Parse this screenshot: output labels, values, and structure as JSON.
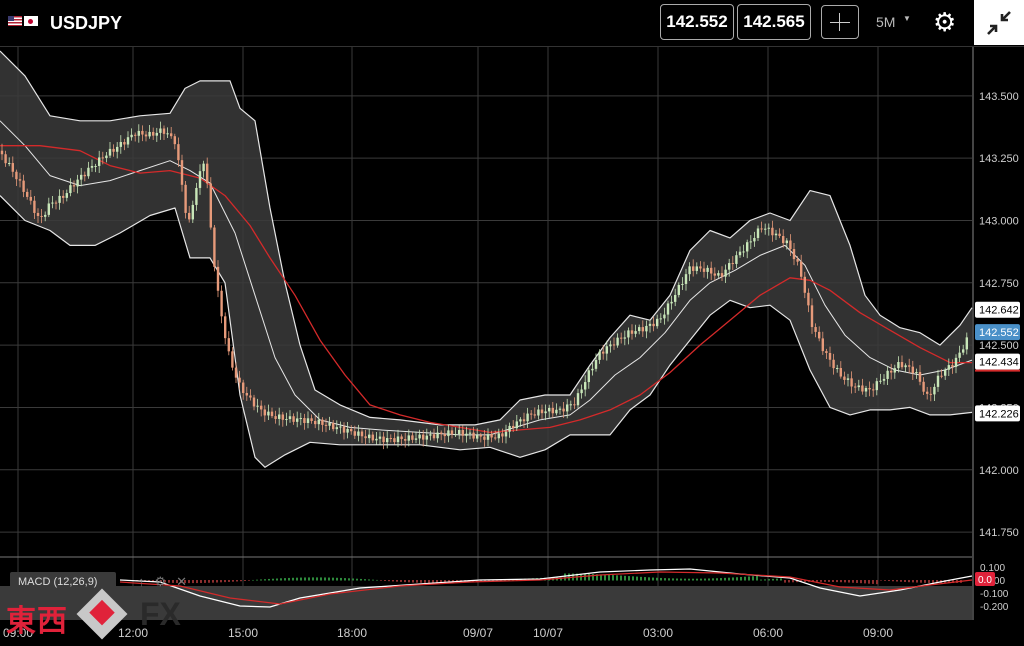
{
  "header": {
    "symbol": "USDJPY",
    "bid": "142.552",
    "ask": "142.565",
    "timeframe": "5M"
  },
  "macd": {
    "label": "MACD (12,26,9)",
    "y_ticks": [
      "0.100",
      "0.000",
      "-0.100",
      "-0.200"
    ],
    "current_value": "0.0"
  },
  "watermark": {
    "kanji": "東西",
    "fx": "FX"
  },
  "chart_data": {
    "type": "candlestick",
    "instrument": "USDJPY",
    "timeframe": "5M",
    "indicators": [
      "Bollinger Bands",
      "Moving Average",
      "MACD (12,26,9)"
    ],
    "x_tick_labels": [
      "09:00",
      "12:00",
      "15:00",
      "18:00",
      "09/07",
      "10/07",
      "03:00",
      "06:00",
      "09:00"
    ],
    "y_tick_labels": [
      "143.500",
      "143.250",
      "143.000",
      "142.750",
      "142.500",
      "142.250",
      "142.000",
      "141.750"
    ],
    "ylim": [
      141.65,
      143.7
    ],
    "price_markers": [
      {
        "value": "142.642",
        "color": "#ffffff"
      },
      {
        "value": "142.552",
        "color": "#4a90c8"
      },
      {
        "value": "142.434",
        "color": "#ffffff"
      },
      {
        "value": "142.226",
        "color": "#ffffff"
      }
    ],
    "close_path": [
      [
        0,
        143.28
      ],
      [
        12,
        143.2
      ],
      [
        25,
        143.1
      ],
      [
        40,
        142.98
      ],
      [
        50,
        143.05
      ],
      [
        62,
        143.08
      ],
      [
        75,
        143.15
      ],
      [
        90,
        143.22
      ],
      [
        105,
        143.28
      ],
      [
        120,
        143.32
      ],
      [
        135,
        143.36
      ],
      [
        150,
        143.34
      ],
      [
        163,
        143.35
      ],
      [
        175,
        143.3
      ],
      [
        183,
        143.1
      ],
      [
        188,
        142.95
      ],
      [
        195,
        143.1
      ],
      [
        205,
        143.25
      ],
      [
        212,
        142.9
      ],
      [
        220,
        142.65
      ],
      [
        230,
        142.45
      ],
      [
        240,
        142.35
      ],
      [
        250,
        142.3
      ],
      [
        262,
        142.25
      ],
      [
        275,
        142.22
      ],
      [
        290,
        142.2
      ],
      [
        310,
        142.18
      ],
      [
        330,
        142.16
      ],
      [
        350,
        142.15
      ],
      [
        370,
        142.14
      ],
      [
        400,
        142.14
      ],
      [
        430,
        142.13
      ],
      [
        460,
        142.13
      ],
      [
        480,
        142.12
      ],
      [
        500,
        142.14
      ],
      [
        515,
        142.2
      ],
      [
        530,
        142.24
      ],
      [
        545,
        142.25
      ],
      [
        560,
        142.24
      ],
      [
        575,
        142.26
      ],
      [
        590,
        142.38
      ],
      [
        600,
        142.45
      ],
      [
        615,
        142.5
      ],
      [
        630,
        142.55
      ],
      [
        645,
        142.58
      ],
      [
        660,
        142.62
      ],
      [
        675,
        142.72
      ],
      [
        690,
        142.82
      ],
      [
        705,
        142.8
      ],
      [
        720,
        142.76
      ],
      [
        735,
        142.83
      ],
      [
        750,
        142.9
      ],
      [
        762,
        142.97
      ],
      [
        775,
        142.95
      ],
      [
        788,
        142.92
      ],
      [
        800,
        142.82
      ],
      [
        812,
        142.6
      ],
      [
        825,
        142.48
      ],
      [
        840,
        142.38
      ],
      [
        855,
        142.32
      ],
      [
        870,
        142.3
      ],
      [
        885,
        142.36
      ],
      [
        900,
        142.42
      ],
      [
        915,
        142.4
      ],
      [
        928,
        142.3
      ],
      [
        940,
        142.4
      ],
      [
        955,
        142.45
      ],
      [
        970,
        142.55
      ]
    ],
    "bb_upper": [
      [
        0,
        143.68
      ],
      [
        25,
        143.58
      ],
      [
        50,
        143.42
      ],
      [
        80,
        143.4
      ],
      [
        110,
        143.4
      ],
      [
        140,
        143.42
      ],
      [
        170,
        143.43
      ],
      [
        185,
        143.53
      ],
      [
        200,
        143.56
      ],
      [
        230,
        143.56
      ],
      [
        240,
        143.45
      ],
      [
        255,
        143.4
      ],
      [
        270,
        143.05
      ],
      [
        285,
        142.75
      ],
      [
        300,
        142.5
      ],
      [
        315,
        142.32
      ],
      [
        340,
        142.26
      ],
      [
        370,
        142.21
      ],
      [
        400,
        142.2
      ],
      [
        440,
        142.18
      ],
      [
        475,
        142.18
      ],
      [
        500,
        142.2
      ],
      [
        520,
        142.28
      ],
      [
        545,
        142.3
      ],
      [
        570,
        142.3
      ],
      [
        590,
        142.42
      ],
      [
        610,
        142.53
      ],
      [
        630,
        142.62
      ],
      [
        650,
        142.6
      ],
      [
        670,
        142.7
      ],
      [
        690,
        142.88
      ],
      [
        710,
        142.96
      ],
      [
        730,
        142.93
      ],
      [
        750,
        143.0
      ],
      [
        770,
        143.03
      ],
      [
        790,
        143.0
      ],
      [
        810,
        143.12
      ],
      [
        830,
        143.1
      ],
      [
        850,
        142.9
      ],
      [
        865,
        142.7
      ],
      [
        880,
        142.62
      ],
      [
        900,
        142.57
      ],
      [
        920,
        142.55
      ],
      [
        940,
        142.5
      ],
      [
        960,
        142.58
      ],
      [
        972,
        142.65
      ]
    ],
    "bb_lower": [
      [
        0,
        143.1
      ],
      [
        25,
        143.0
      ],
      [
        50,
        142.96
      ],
      [
        70,
        142.9
      ],
      [
        95,
        142.9
      ],
      [
        120,
        142.95
      ],
      [
        150,
        143.02
      ],
      [
        175,
        143.05
      ],
      [
        190,
        142.85
      ],
      [
        210,
        142.85
      ],
      [
        225,
        142.75
      ],
      [
        240,
        142.3
      ],
      [
        255,
        142.05
      ],
      [
        265,
        142.01
      ],
      [
        285,
        142.06
      ],
      [
        310,
        142.11
      ],
      [
        340,
        142.1
      ],
      [
        380,
        142.1
      ],
      [
        420,
        142.1
      ],
      [
        460,
        142.08
      ],
      [
        490,
        142.09
      ],
      [
        520,
        142.05
      ],
      [
        545,
        142.08
      ],
      [
        570,
        142.14
      ],
      [
        590,
        142.14
      ],
      [
        610,
        142.14
      ],
      [
        630,
        142.24
      ],
      [
        650,
        142.3
      ],
      [
        670,
        142.42
      ],
      [
        690,
        142.52
      ],
      [
        710,
        142.62
      ],
      [
        730,
        142.68
      ],
      [
        750,
        142.65
      ],
      [
        770,
        142.66
      ],
      [
        790,
        142.6
      ],
      [
        810,
        142.4
      ],
      [
        830,
        142.25
      ],
      [
        850,
        142.22
      ],
      [
        870,
        142.24
      ],
      [
        890,
        142.24
      ],
      [
        910,
        142.25
      ],
      [
        930,
        142.22
      ],
      [
        950,
        142.22
      ],
      [
        972,
        142.23
      ]
    ],
    "bb_middle": [
      [
        0,
        143.4
      ],
      [
        25,
        143.3
      ],
      [
        50,
        143.18
      ],
      [
        80,
        143.14
      ],
      [
        110,
        143.16
      ],
      [
        140,
        143.2
      ],
      [
        170,
        143.24
      ],
      [
        190,
        143.2
      ],
      [
        210,
        143.15
      ],
      [
        235,
        142.95
      ],
      [
        255,
        142.7
      ],
      [
        275,
        142.45
      ],
      [
        295,
        142.3
      ],
      [
        320,
        142.2
      ],
      [
        350,
        142.17
      ],
      [
        380,
        142.16
      ],
      [
        420,
        142.15
      ],
      [
        460,
        142.14
      ],
      [
        490,
        142.14
      ],
      [
        515,
        142.17
      ],
      [
        540,
        142.2
      ],
      [
        570,
        142.22
      ],
      [
        590,
        142.28
      ],
      [
        615,
        142.38
      ],
      [
        640,
        142.45
      ],
      [
        665,
        142.55
      ],
      [
        690,
        142.68
      ],
      [
        710,
        142.75
      ],
      [
        735,
        142.8
      ],
      [
        760,
        142.86
      ],
      [
        785,
        142.9
      ],
      [
        805,
        142.82
      ],
      [
        825,
        142.66
      ],
      [
        845,
        142.54
      ],
      [
        870,
        142.45
      ],
      [
        895,
        142.4
      ],
      [
        920,
        142.38
      ],
      [
        945,
        142.4
      ],
      [
        972,
        142.44
      ]
    ],
    "moving_average": [
      [
        0,
        143.3
      ],
      [
        40,
        143.3
      ],
      [
        80,
        143.28
      ],
      [
        110,
        143.22
      ],
      [
        140,
        143.19
      ],
      [
        170,
        143.2
      ],
      [
        200,
        143.17
      ],
      [
        225,
        143.1
      ],
      [
        250,
        142.98
      ],
      [
        270,
        142.85
      ],
      [
        295,
        142.7
      ],
      [
        320,
        142.52
      ],
      [
        345,
        142.38
      ],
      [
        370,
        142.26
      ],
      [
        400,
        142.22
      ],
      [
        430,
        142.19
      ],
      [
        460,
        142.17
      ],
      [
        490,
        142.15
      ],
      [
        520,
        142.16
      ],
      [
        550,
        142.17
      ],
      [
        580,
        142.2
      ],
      [
        610,
        142.24
      ],
      [
        640,
        142.3
      ],
      [
        670,
        142.39
      ],
      [
        700,
        142.5
      ],
      [
        730,
        142.6
      ],
      [
        760,
        142.7
      ],
      [
        790,
        142.77
      ],
      [
        810,
        142.76
      ],
      [
        830,
        142.72
      ],
      [
        860,
        142.63
      ],
      [
        890,
        142.56
      ],
      [
        920,
        142.49
      ],
      [
        950,
        142.43
      ],
      [
        972,
        142.43
      ]
    ]
  }
}
